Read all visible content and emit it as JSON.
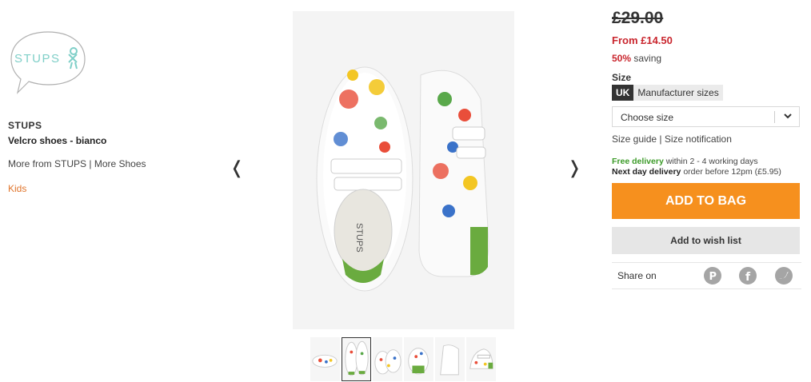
{
  "brand": {
    "logo_text": "STUPS",
    "name": "STUPS",
    "product_name": "Velcro shoes - bianco",
    "more_from": "More from STUPS",
    "separator": "|",
    "more_category": "More Shoes",
    "category_link": "Kids"
  },
  "carousel": {
    "prev_icon": "❬",
    "next_icon": "❭",
    "thumbnail_count": 6,
    "active_thumbnail": 1
  },
  "pricing": {
    "old_price": "£29.00",
    "new_price": "From £14.50",
    "saving_pct": "50%",
    "saving_text": "saving"
  },
  "size": {
    "label": "Size",
    "tabs": [
      "UK",
      "Manufacturer sizes"
    ],
    "select_placeholder": "Choose size",
    "guide_link": "Size guide",
    "links_separator": "|",
    "notification_link": "Size notification"
  },
  "delivery": {
    "free_label": "Free delivery",
    "free_text": "within 2 - 4 working days",
    "next_label": "Next day delivery",
    "next_text": "order before 12pm (£5.95)"
  },
  "actions": {
    "add_to_bag": "ADD TO BAG",
    "wish_list": "Add to wish list"
  },
  "share": {
    "label": "Share on",
    "networks": [
      "pinterest",
      "facebook",
      "twitter"
    ]
  },
  "colors": {
    "accent_orange": "#f6901e",
    "sale_red": "#c9252d",
    "delivery_green": "#3c9b29",
    "kids_orange": "#e0742b"
  }
}
